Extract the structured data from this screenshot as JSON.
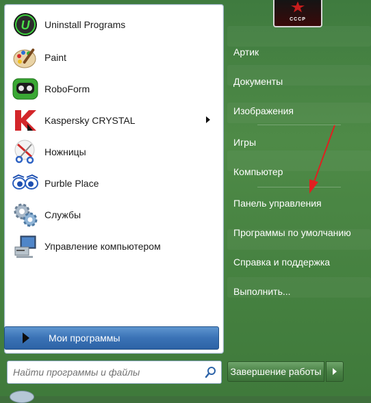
{
  "left_programs": [
    {
      "label": "Uninstall Programs",
      "icon": "uninstall-icon"
    },
    {
      "label": "Paint",
      "icon": "paint-palette-icon"
    },
    {
      "label": "RoboForm",
      "icon": "roboform-icon"
    },
    {
      "label": "Kaspersky CRYSTAL",
      "icon": "kaspersky-icon",
      "has_submenu": true
    },
    {
      "label": "Ножницы",
      "icon": "scissors-icon"
    },
    {
      "label": "Purble Place",
      "icon": "purble-place-icon"
    },
    {
      "label": "Службы",
      "icon": "services-gear-icon"
    },
    {
      "label": "Управление компьютером",
      "icon": "computer-management-icon"
    }
  ],
  "all_programs_label": "Мои программы",
  "search": {
    "placeholder": "Найти программы и файлы",
    "value": ""
  },
  "right_links": [
    {
      "label": "Артик"
    },
    {
      "label": "Документы"
    },
    {
      "label": "Изображения"
    },
    {
      "label": "Игры"
    },
    {
      "label": "Компьютер"
    },
    {
      "label": "Панель управления"
    },
    {
      "label": "Программы по умолчанию"
    },
    {
      "label": "Справка и поддержка"
    },
    {
      "label": "Выполнить..."
    }
  ],
  "user_picture_caption": "СССР",
  "shutdown_label": "Завершение работы",
  "colors": {
    "annotation_arrow": "#e02020",
    "accent_blue": "#3a72b6",
    "menu_green": "#4e8a47"
  }
}
